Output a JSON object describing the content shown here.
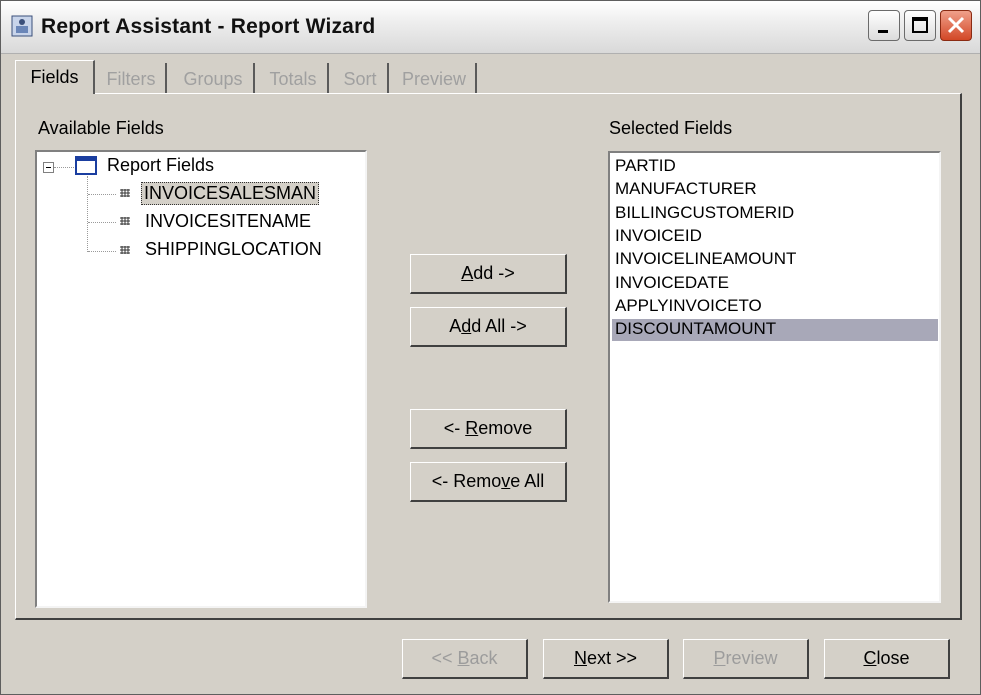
{
  "window": {
    "title": "Report Assistant - Report Wizard",
    "controls": [
      "minimize",
      "maximize",
      "close"
    ]
  },
  "tabs": [
    {
      "label": "Fields",
      "active": true
    },
    {
      "label": "Filters",
      "active": false
    },
    {
      "label": "Groups",
      "active": false
    },
    {
      "label": "Totals",
      "active": false
    },
    {
      "label": "Sort",
      "active": false
    },
    {
      "label": "Preview",
      "active": false
    }
  ],
  "available": {
    "label": "Available Fields",
    "root": "Report Fields",
    "items": [
      "INVOICESALESMAN",
      "INVOICESITENAME",
      "SHIPPINGLOCATION"
    ],
    "selected_index": 0
  },
  "selected": {
    "label": "Selected Fields",
    "items": [
      "PARTID",
      "MANUFACTURER",
      "BILLINGCUSTOMERID",
      "INVOICEID",
      "INVOICELINEAMOUNT",
      "INVOICEDATE",
      "APPLYINVOICETO",
      "DISCOUNTAMOUNT"
    ],
    "selected_index": 7
  },
  "actions": {
    "add": {
      "pre": "",
      "mnemonic": "A",
      "post": "dd ->"
    },
    "add_all": {
      "pre": "A",
      "mnemonic": "d",
      "post": "d All ->"
    },
    "remove": {
      "pre": "<- ",
      "mnemonic": "R",
      "post": "emove"
    },
    "remove_all": {
      "pre": "<- Remo",
      "mnemonic": "v",
      "post": "e All"
    }
  },
  "footer": {
    "back": {
      "pre": "<< ",
      "mnemonic": "B",
      "post": "ack",
      "enabled": false
    },
    "next": {
      "pre": "",
      "mnemonic": "N",
      "post": "ext >>",
      "enabled": true
    },
    "preview": {
      "pre": "",
      "mnemonic": "P",
      "post": "review",
      "enabled": false
    },
    "close": {
      "pre": "",
      "mnemonic": "C",
      "post": "lose",
      "enabled": true
    }
  },
  "colors": {
    "dialog_bg": "#d4d0c8",
    "selection_bg": "#a8a8b8",
    "tree_icon_blue": "#1a3ea0",
    "close_button_red": "#d24726"
  }
}
